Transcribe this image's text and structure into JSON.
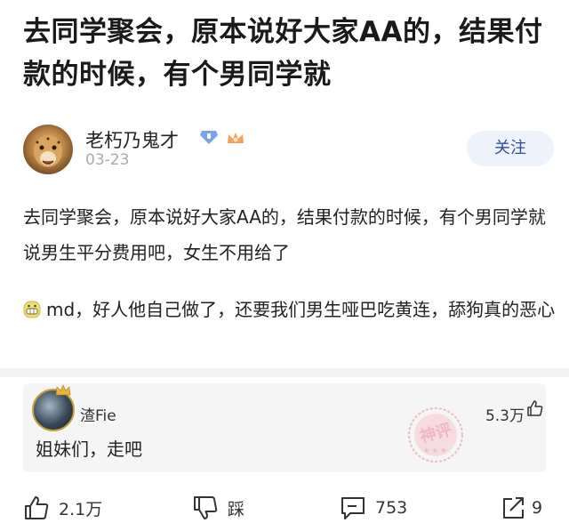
{
  "post": {
    "title": "去同学聚会，原本说好大家AA的，结果付款的时候，有个男同学就",
    "author": "老朽乃鬼才",
    "date": "03-23",
    "follow_label": "关注",
    "body_p1": "去同学聚会，原本说好大家AA的，结果付款的时候，有个男同学就说男生平分费用吧，女生不用给了",
    "body_p2": "md，好人他自己做了，还要我们男生哑巴吃黄连，舔狗真的恶心"
  },
  "comment": {
    "user": "渣Fie",
    "likes": "5.3万",
    "text": "姐妹们，走吧",
    "stamp": "神评"
  },
  "actions": {
    "like_count": "2.1万",
    "dislike_label": "踩",
    "comment_count": "753",
    "share_count": "9"
  },
  "colors": {
    "follow_bg": "#eef2fb",
    "follow_text": "#2d4f9a",
    "comment_bg": "#f5f5f5",
    "stamp": "#e7889b"
  }
}
